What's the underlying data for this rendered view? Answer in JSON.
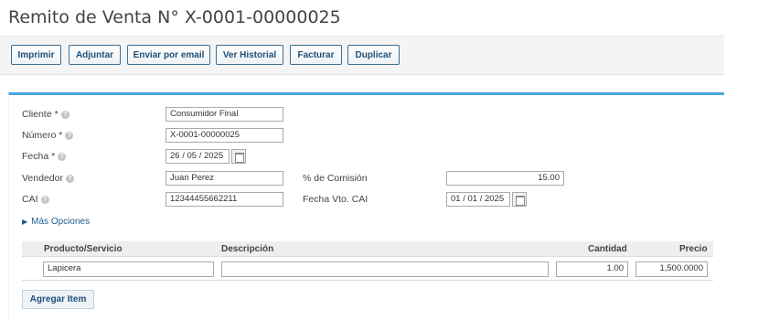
{
  "page": {
    "title": "Remito de Venta N° X-0001-00000025"
  },
  "toolbar": {
    "print": "Imprimir",
    "attach": "Adjuntar",
    "email": "Enviar por email",
    "history": "Ver Historial",
    "invoice": "Facturar",
    "duplicate": "Duplicar"
  },
  "form": {
    "client": {
      "label": "Cliente *",
      "value": "Consumidor Final"
    },
    "number": {
      "label": "Número *",
      "value": "X-0001-00000025"
    },
    "date": {
      "label": "Fecha *",
      "value": "26 / 05 /  2025"
    },
    "seller": {
      "label": "Vendedor",
      "value": "Juan Perez"
    },
    "commission": {
      "label": "% de Comisión",
      "value": "15.00"
    },
    "cai": {
      "label": "CAI",
      "value": "12344455662211"
    },
    "cai_expiry": {
      "label": "Fecha Vto. CAI",
      "value": "01 / 01 /  2025"
    },
    "help_glyph": "?"
  },
  "more_options": {
    "arrow": "▶",
    "label": "Más Opciones"
  },
  "items": {
    "columns": {
      "product": "Producto/Servicio",
      "description": "Descripción",
      "quantity": "Cantidad",
      "price": "Precio"
    },
    "rows": [
      {
        "product": "Lapicera",
        "description": "",
        "quantity": "1.00",
        "price": "1,500.0000"
      }
    ]
  },
  "add_item_label": "Agregar Item",
  "colors": {
    "accent": "#48a8dc",
    "button_border": "#3d6f93",
    "link": "#1f5f8b"
  }
}
